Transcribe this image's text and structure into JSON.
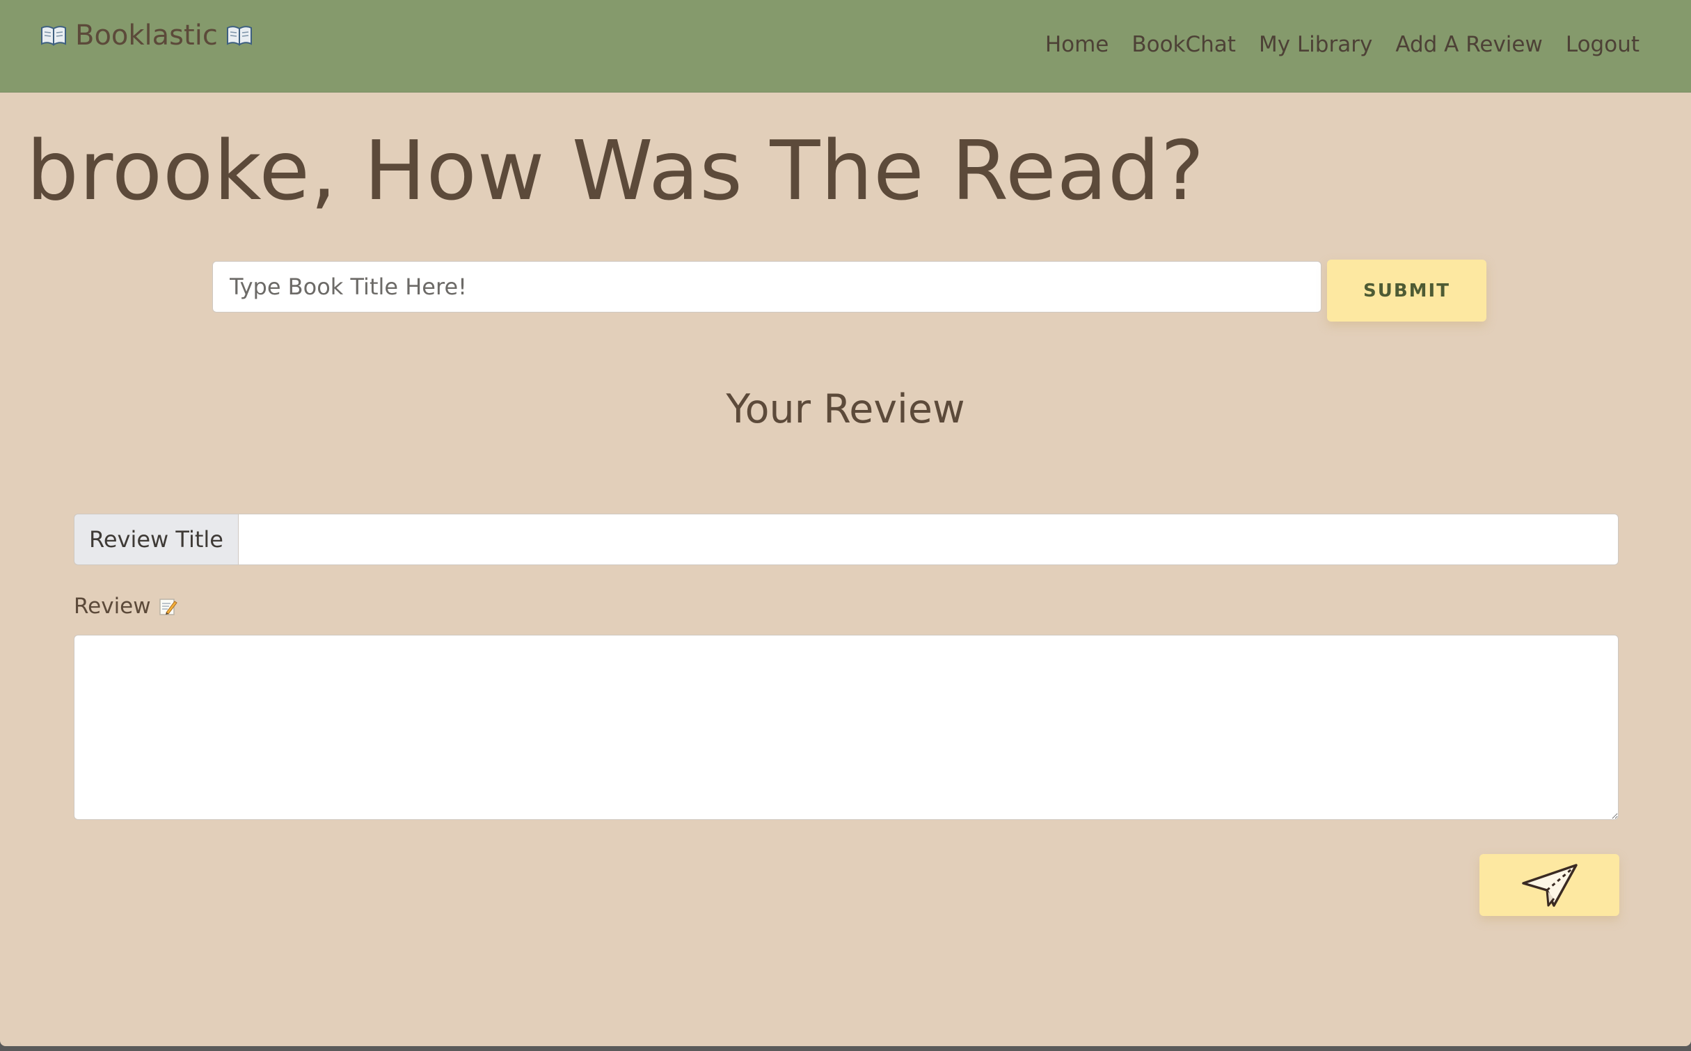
{
  "navbar": {
    "brand": "Booklastic",
    "links": [
      {
        "label": "Home"
      },
      {
        "label": "BookChat"
      },
      {
        "label": "My Library"
      },
      {
        "label": "Add A Review"
      },
      {
        "label": "Logout"
      }
    ]
  },
  "main": {
    "heading": "brooke, How Was The Read?",
    "search": {
      "placeholder": "Type Book Title Here!",
      "value": "",
      "submit_label": "SUBMIT"
    },
    "review_section_title": "Your Review",
    "review_title_field": {
      "addon_label": "Review Title",
      "value": ""
    },
    "review_field": {
      "label": "Review",
      "value": ""
    },
    "send_icon": "paper-plane-icon"
  },
  "colors": {
    "navbar": "#859a6c",
    "background": "#e2cfba",
    "text": "#5c4a3a",
    "button": "#fde8a1",
    "button_text": "#4e5b34"
  },
  "icons": [
    "open-book-icon",
    "memo-icon",
    "paper-plane-icon"
  ]
}
